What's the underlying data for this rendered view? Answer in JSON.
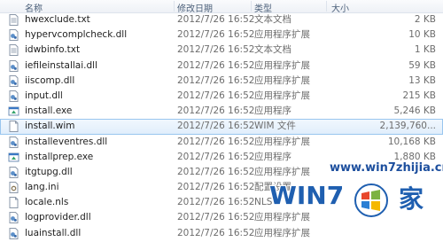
{
  "columns": {
    "name": "名称",
    "date": "修改日期",
    "type": "类型",
    "size": "大小"
  },
  "files": [
    {
      "name": "hwexclude.txt",
      "date": "2012/7/26 16:52",
      "type": "文本文档",
      "size": "2 KB",
      "icon": "text-file-icon"
    },
    {
      "name": "hypervcomplcheck.dll",
      "date": "2012/7/26 16:52",
      "type": "应用程序扩展",
      "size": "10 KB",
      "icon": "dll-file-icon"
    },
    {
      "name": "idwbinfo.txt",
      "date": "2012/7/26 16:52",
      "type": "文本文档",
      "size": "1 KB",
      "icon": "text-file-icon"
    },
    {
      "name": "iefileinstallai.dll",
      "date": "2012/7/26 16:52",
      "type": "应用程序扩展",
      "size": "59 KB",
      "icon": "dll-file-icon"
    },
    {
      "name": "iiscomp.dll",
      "date": "2012/7/26 16:52",
      "type": "应用程序扩展",
      "size": "13 KB",
      "icon": "dll-file-icon"
    },
    {
      "name": "input.dll",
      "date": "2012/7/26 16:52",
      "type": "应用程序扩展",
      "size": "215 KB",
      "icon": "dll-file-icon"
    },
    {
      "name": "install.exe",
      "date": "2012/7/26 16:52",
      "type": "应用程序",
      "size": "5,246 KB",
      "icon": "exe-file-icon"
    },
    {
      "name": "install.wim",
      "date": "2012/7/26 16:52",
      "type": "WIM 文件",
      "size": "2,139,760...",
      "icon": "blank-file-icon",
      "selected": true
    },
    {
      "name": "installeventres.dll",
      "date": "2012/7/26 16:52",
      "type": "应用程序扩展",
      "size": "10,168 KB",
      "icon": "dll-file-icon"
    },
    {
      "name": "installprep.exe",
      "date": "2012/7/26 16:52",
      "type": "应用程序",
      "size": "1,880 KB",
      "icon": "exe-file-icon"
    },
    {
      "name": "itgtupg.dll",
      "date": "2012/7/26 16:52",
      "type": "应用程序扩展",
      "size": "",
      "icon": "dll-file-icon"
    },
    {
      "name": "lang.ini",
      "date": "2012/7/26 16:52",
      "type": "配置设置",
      "size": "",
      "icon": "ini-file-icon"
    },
    {
      "name": "locale.nls",
      "date": "2012/7/26 16:52",
      "type": "NLS",
      "size": "",
      "icon": "blank-file-icon"
    },
    {
      "name": "logprovider.dll",
      "date": "2012/7/26 16:52",
      "type": "应用程序扩展",
      "size": "",
      "icon": "dll-file-icon"
    },
    {
      "name": "luainstall.dll",
      "date": "2012/7/26 16:52",
      "type": "应用程序扩展",
      "size": "",
      "icon": "dll-file-icon"
    }
  ],
  "watermark": {
    "site": "www.win7zhijia.cn",
    "brand": "WIN7",
    "suffix": "家"
  },
  "colors": {
    "selection_bg": "#dfedfb",
    "selection_border": "#99c6ef",
    "header_text": "#4c607a",
    "watermark": "#1f5fb0"
  }
}
